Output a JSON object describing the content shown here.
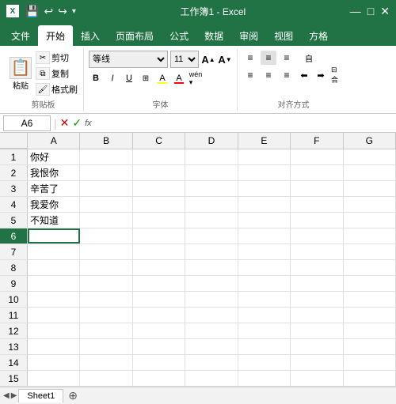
{
  "titleBar": {
    "appIcon": "X",
    "title": "工作簿1 - Excel",
    "quickAccess": [
      "💾",
      "↩",
      "↪",
      "▭",
      "▾"
    ],
    "windowBtns": [
      "—",
      "□",
      "✕"
    ]
  },
  "ribbonTabs": [
    "文件",
    "开始",
    "插入",
    "页面布局",
    "公式",
    "数据",
    "审阅",
    "视图",
    "方格"
  ],
  "activeTab": "开始",
  "clipboard": {
    "label": "剪贴板",
    "pasteIcon": "📋",
    "pasteLabel": "粘贴",
    "cutLabel": "✂",
    "copyLabel": "📄",
    "formatLabel": "🖌"
  },
  "font": {
    "label": "字体",
    "name": "等线",
    "size": "11",
    "sizeUpIcon": "A↑",
    "sizeDownIcon": "A↓",
    "bold": "B",
    "italic": "I",
    "underline": "U",
    "borderIcon": "⊞",
    "fillIcon": "A",
    "fillColor": "#ffff00",
    "fontColor": "A",
    "fontColorLine": "#ff0000"
  },
  "alignment": {
    "label": "对齐方式",
    "topLeft": "≡↖",
    "topCenter": "≡↑",
    "topRight": "≡↗",
    "middleLeft": "≡←",
    "middleCenter": "≡",
    "middleRight": "≡→",
    "wrapText": "自",
    "mergeIcon": "⊟"
  },
  "formulaBar": {
    "cellRef": "A6",
    "xBtn": "✕",
    "checkBtn": "✓",
    "fxLabel": "fx",
    "value": ""
  },
  "columns": [
    "A",
    "B",
    "C",
    "D",
    "E",
    "F",
    "G"
  ],
  "rows": [
    {
      "num": 1,
      "cells": [
        "你好",
        "",
        "",
        "",
        "",
        "",
        ""
      ]
    },
    {
      "num": 2,
      "cells": [
        "我恨你",
        "",
        "",
        "",
        "",
        "",
        ""
      ]
    },
    {
      "num": 3,
      "cells": [
        "辛苦了",
        "",
        "",
        "",
        "",
        "",
        ""
      ]
    },
    {
      "num": 4,
      "cells": [
        "我爱你",
        "",
        "",
        "",
        "",
        "",
        ""
      ]
    },
    {
      "num": 5,
      "cells": [
        "不知道",
        "",
        "",
        "",
        "",
        "",
        ""
      ]
    },
    {
      "num": 6,
      "cells": [
        "",
        "",
        "",
        "",
        "",
        "",
        ""
      ]
    },
    {
      "num": 7,
      "cells": [
        "",
        "",
        "",
        "",
        "",
        "",
        ""
      ]
    },
    {
      "num": 8,
      "cells": [
        "",
        "",
        "",
        "",
        "",
        "",
        ""
      ]
    },
    {
      "num": 9,
      "cells": [
        "",
        "",
        "",
        "",
        "",
        "",
        ""
      ]
    },
    {
      "num": 10,
      "cells": [
        "",
        "",
        "",
        "",
        "",
        "",
        ""
      ]
    },
    {
      "num": 11,
      "cells": [
        "",
        "",
        "",
        "",
        "",
        "",
        ""
      ]
    },
    {
      "num": 12,
      "cells": [
        "",
        "",
        "",
        "",
        "",
        "",
        ""
      ]
    },
    {
      "num": 13,
      "cells": [
        "",
        "",
        "",
        "",
        "",
        "",
        ""
      ]
    },
    {
      "num": 14,
      "cells": [
        "",
        "",
        "",
        "",
        "",
        "",
        ""
      ]
    },
    {
      "num": 15,
      "cells": [
        "",
        "",
        "",
        "",
        "",
        "",
        ""
      ]
    }
  ],
  "activeCell": {
    "row": 6,
    "col": 0
  },
  "sheetTabs": [
    "Sheet1"
  ],
  "colors": {
    "excel_green": "#217346",
    "ribbon_bg": "#ffffff",
    "header_bg": "#f2f2f2",
    "cell_border": "#e0e0e0",
    "selected_row": "#e6f2ea"
  }
}
